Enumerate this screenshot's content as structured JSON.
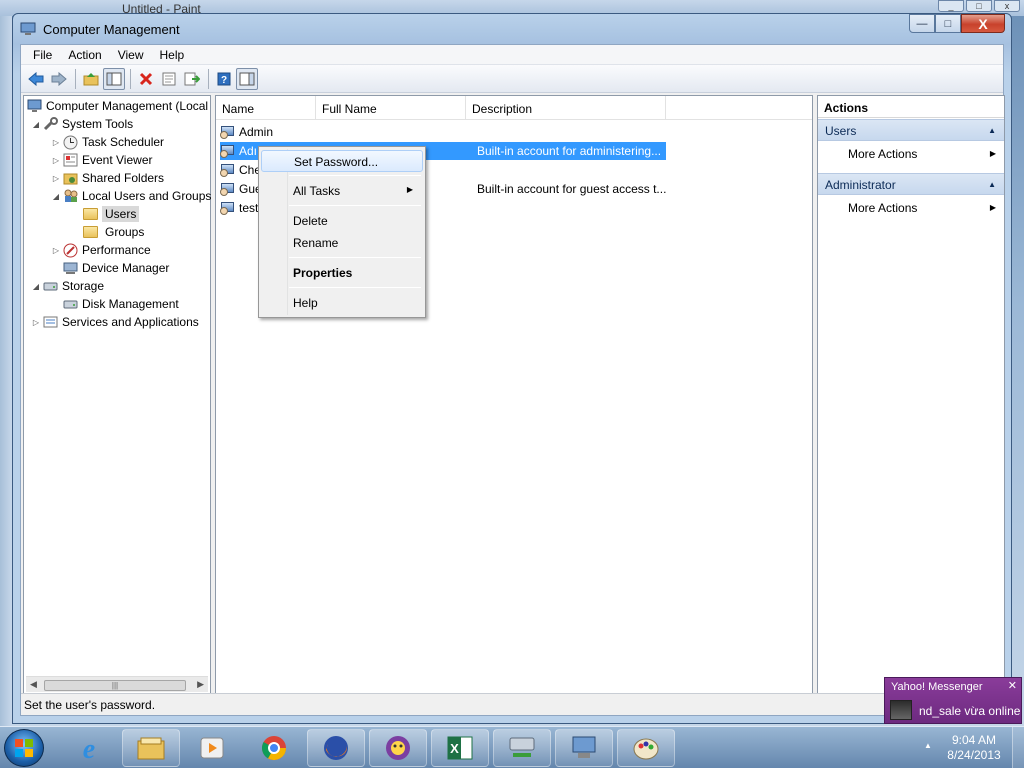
{
  "background_window": {
    "title": "Untitled - Paint"
  },
  "window": {
    "title": "Computer Management",
    "controls": {
      "minimize": "—",
      "maximize": "□",
      "close": "X"
    }
  },
  "menu": [
    "File",
    "Action",
    "View",
    "Help"
  ],
  "toolbar": [
    "back-arrow-icon",
    "forward-arrow-icon",
    "up-folder-icon",
    "show-hide-tree-icon",
    "delete-icon",
    "properties-icon",
    "export-list-icon",
    "help-icon",
    "show-hide-action-pane-icon"
  ],
  "tree": {
    "root": "Computer Management (Local",
    "system_tools": "System Tools",
    "task_scheduler": "Task Scheduler",
    "event_viewer": "Event Viewer",
    "shared_folders": "Shared Folders",
    "local_users_groups": "Local Users and Groups",
    "users": "Users",
    "groups": "Groups",
    "performance": "Performance",
    "device_manager": "Device Manager",
    "storage": "Storage",
    "disk_management": "Disk Management",
    "services_apps": "Services and Applications"
  },
  "list": {
    "columns": [
      "Name",
      "Full Name",
      "Description"
    ],
    "rows": [
      {
        "name": "Admin",
        "full_name": "",
        "description": ""
      },
      {
        "name": "Administrator",
        "visible_name": "Adı",
        "full_name": "",
        "description": "Built-in account for administering..."
      },
      {
        "name": "Che",
        "full_name": "",
        "description": ""
      },
      {
        "name": "Gue",
        "full_name": "",
        "description": "Built-in account for guest access t..."
      },
      {
        "name": "test",
        "full_name": "",
        "description": ""
      }
    ]
  },
  "context_menu": {
    "set_password": "Set Password...",
    "all_tasks": "All Tasks",
    "delete": "Delete",
    "rename": "Rename",
    "properties": "Properties",
    "help": "Help"
  },
  "actions": {
    "header": "Actions",
    "group1": "Users",
    "group1_more": "More Actions",
    "group2": "Administrator",
    "group2_more": "More Actions"
  },
  "status": "Set the user's password.",
  "yahoo": {
    "header": "Yahoo! Messenger",
    "message": "nd_sale vừa online"
  },
  "clock": {
    "time": "9:04 AM",
    "date": "8/24/2013"
  }
}
